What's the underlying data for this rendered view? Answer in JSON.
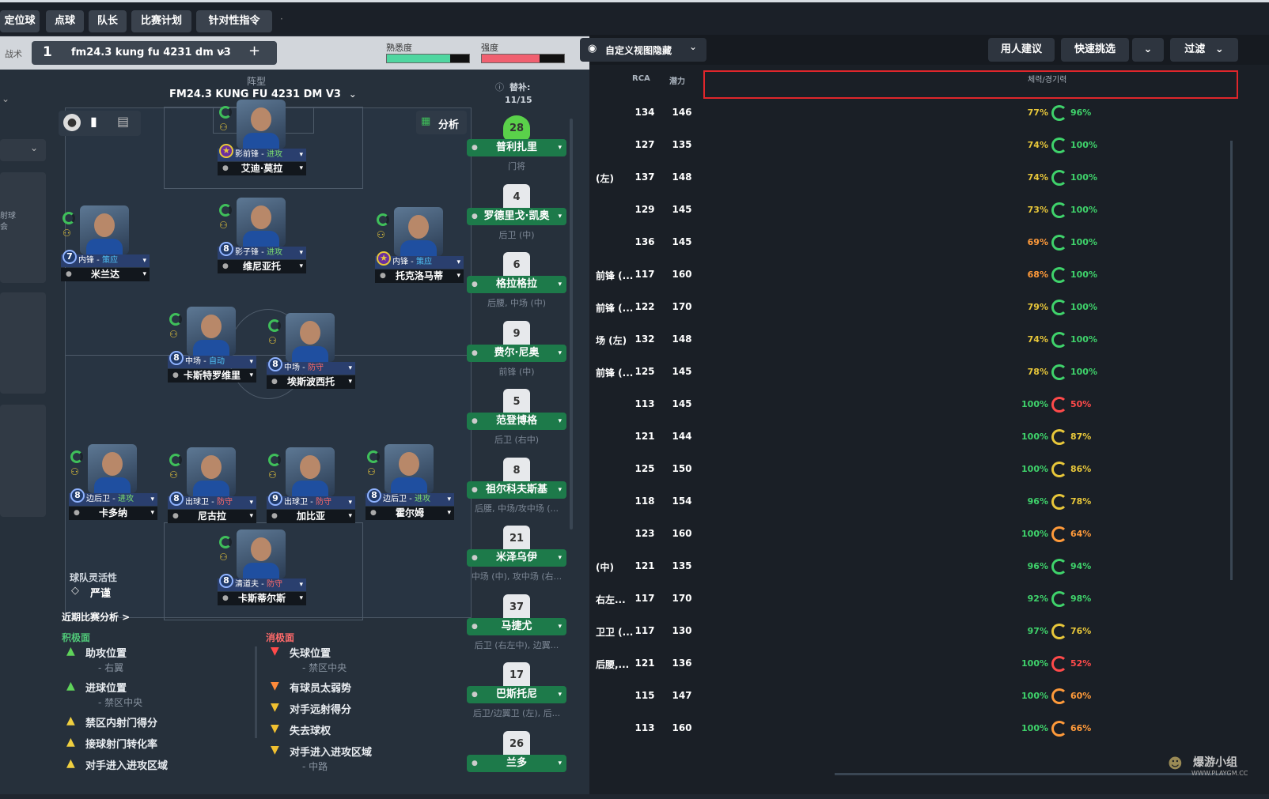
{
  "top_tabs": [
    "定位球",
    "点球",
    "队长",
    "比赛计划",
    "针对性指令"
  ],
  "tactic": {
    "label": "战术",
    "slot": "1",
    "name": "fm24.3 kung fu 4231 dm v3",
    "add": "+",
    "familiarity_label": "熟悉度",
    "familiarity": 0.77,
    "intensity_label": "强度",
    "intensity": 0.7
  },
  "formation": {
    "label": "阵型",
    "name": "FM24.3 KUNG FU 4231 DM V3"
  },
  "subs": {
    "label": "替补:",
    "count": "11/15"
  },
  "pitch_tools": {
    "analysis": "分析"
  },
  "players": [
    {
      "id": "st",
      "num": "",
      "role": "影前锋 - ",
      "duty": "进攻",
      "name": "艾迪·莫拉"
    },
    {
      "id": "lw",
      "num": "7",
      "role": "内锋 - ",
      "duty": "策应",
      "name": "米兰达"
    },
    {
      "id": "am",
      "num": "8",
      "role": "影子锋 - ",
      "duty": "进攻",
      "name": "维尼亚托"
    },
    {
      "id": "rw",
      "num": "",
      "role": "内锋 - ",
      "duty": "策应",
      "name": "托克洛马蒂"
    },
    {
      "id": "cm1",
      "num": "8",
      "role": "中场 - ",
      "duty": "自动",
      "name": "卡斯特罗维里"
    },
    {
      "id": "cm2",
      "num": "8",
      "role": "中场 - ",
      "duty": "防守",
      "name": "埃斯波西托"
    },
    {
      "id": "lb",
      "num": "8",
      "role": "边后卫 - ",
      "duty": "进攻",
      "name": "卡多纳"
    },
    {
      "id": "cb1",
      "num": "8",
      "role": "出球卫 - ",
      "duty": "防守",
      "name": "尼古拉"
    },
    {
      "id": "cb2",
      "num": "9",
      "role": "出球卫 - ",
      "duty": "防守",
      "name": "加比亚"
    },
    {
      "id": "rb",
      "num": "8",
      "role": "边后卫 - ",
      "duty": "进攻",
      "name": "霍尔姆"
    },
    {
      "id": "gk",
      "num": "8",
      "role": "清道夫 - ",
      "duty": "防守",
      "name": "卡斯蒂尔斯"
    }
  ],
  "bench": [
    {
      "shirt": "28",
      "name": "普利扎里",
      "pos": "门将"
    },
    {
      "shirt": "4",
      "name": "罗德里戈·凯奥",
      "pos": "后卫 (中)"
    },
    {
      "shirt": "6",
      "name": "格拉格拉",
      "pos": "后腰, 中场 (中)"
    },
    {
      "shirt": "9",
      "name": "费尔·尼奥",
      "pos": "前锋 (中)"
    },
    {
      "shirt": "5",
      "name": "范登博格",
      "pos": "后卫 (右中)"
    },
    {
      "shirt": "8",
      "name": "祖尔科夫斯基",
      "pos": "后腰, 中场/攻中场 (..."
    },
    {
      "shirt": "21",
      "name": "米泽乌伊",
      "pos": "中场 (中), 攻中场 (右..."
    },
    {
      "shirt": "37",
      "name": "马捷尤",
      "pos": "后卫 (右左中), 边翼..."
    },
    {
      "shirt": "17",
      "name": "巴斯托尼",
      "pos": "后卫/边翼卫 (左), 后..."
    },
    {
      "shirt": "26",
      "name": "兰多",
      "pos": ""
    }
  ],
  "left_side": {
    "fluidity_label": "球队灵活性",
    "fluidity_value": "严谨",
    "recent": "近期比赛分析 >",
    "side_text_1": "射球",
    "side_text_2": "会"
  },
  "analysis": {
    "positive_title": "积极面",
    "positive": [
      {
        "t": "助攻位置",
        "s": "- 右翼"
      },
      {
        "t": "进球位置",
        "s": "- 禁区中央"
      },
      {
        "t": "禁区内射门得分",
        "s": ""
      },
      {
        "t": "接球射门转化率",
        "s": ""
      },
      {
        "t": "对手进入进攻区域",
        "s": ""
      }
    ],
    "negative_title": "消极面",
    "negative": [
      {
        "t": "失球位置",
        "s": "- 禁区中央"
      },
      {
        "t": "有球员太弱势",
        "s": ""
      },
      {
        "t": "对手远射得分",
        "s": ""
      },
      {
        "t": "失去球权",
        "s": ""
      },
      {
        "t": "对手进入进攻区域",
        "s": "- 中路"
      }
    ]
  },
  "right": {
    "view_toggle": "自定义视图隐藏",
    "buttons": {
      "advice": "用人建议",
      "quick": "快速挑选",
      "filter": "过滤"
    },
    "columns": {
      "rca": "RCA",
      "pot": "潜力",
      "fitness": "체력/경기력"
    },
    "rows": [
      {
        "pos": "",
        "rca": "134",
        "pot": "146",
        "fit": "77%",
        "cond": "96%"
      },
      {
        "pos": "",
        "rca": "127",
        "pot": "135",
        "fit": "74%",
        "cond": "100%"
      },
      {
        "pos": "(左)",
        "rca": "137",
        "pot": "148",
        "fit": "74%",
        "cond": "100%"
      },
      {
        "pos": "",
        "rca": "129",
        "pot": "145",
        "fit": "73%",
        "cond": "100%"
      },
      {
        "pos": "",
        "rca": "136",
        "pot": "145",
        "fit": "69%",
        "cond": "100%"
      },
      {
        "pos": "前锋 (...",
        "rca": "117",
        "pot": "160",
        "fit": "68%",
        "cond": "100%"
      },
      {
        "pos": "前锋 (...",
        "rca": "122",
        "pot": "170",
        "fit": "79%",
        "cond": "100%"
      },
      {
        "pos": "场 (左)",
        "rca": "132",
        "pot": "148",
        "fit": "74%",
        "cond": "100%"
      },
      {
        "pos": "前锋 (...",
        "rca": "125",
        "pot": "145",
        "fit": "78%",
        "cond": "100%"
      },
      {
        "pos": "",
        "rca": "113",
        "pot": "145",
        "fit": "100%",
        "cond": "50%"
      },
      {
        "pos": "",
        "rca": "121",
        "pot": "144",
        "fit": "100%",
        "cond": "87%"
      },
      {
        "pos": "",
        "rca": "125",
        "pot": "150",
        "fit": "100%",
        "cond": "86%"
      },
      {
        "pos": "",
        "rca": "118",
        "pot": "154",
        "fit": "96%",
        "cond": "78%"
      },
      {
        "pos": "",
        "rca": "123",
        "pot": "160",
        "fit": "100%",
        "cond": "64%"
      },
      {
        "pos": "(中)",
        "rca": "121",
        "pot": "135",
        "fit": "96%",
        "cond": "94%"
      },
      {
        "pos": "右左...",
        "rca": "117",
        "pot": "170",
        "fit": "92%",
        "cond": "98%"
      },
      {
        "pos": "卫卫 (...",
        "rca": "117",
        "pot": "130",
        "fit": "97%",
        "cond": "76%"
      },
      {
        "pos": "后腰,...",
        "rca": "121",
        "pot": "136",
        "fit": "100%",
        "cond": "52%"
      },
      {
        "pos": "",
        "rca": "115",
        "pot": "147",
        "fit": "100%",
        "cond": "60%"
      },
      {
        "pos": "",
        "rca": "113",
        "pot": "160",
        "fit": "100%",
        "cond": "66%"
      }
    ]
  },
  "watermark": {
    "cn": "爆游小组",
    "url": "WWW.PLAYGM.CC"
  },
  "colors": {
    "highlight_box": "#e0262b",
    "green": "#3fd36b",
    "orange": "#f0c030",
    "red": "#ff4a4a"
  }
}
